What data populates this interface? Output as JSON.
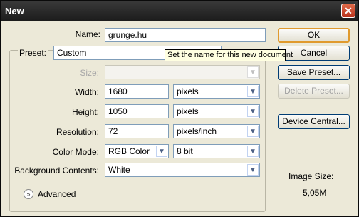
{
  "window": {
    "title": "New",
    "close_symbol": "✕"
  },
  "form": {
    "name_label": "Name:",
    "name_value": "grunge.hu",
    "preset_label": "Preset:",
    "preset_value": "Custom",
    "size_label": "Size:",
    "size_value": "",
    "width_label": "Width:",
    "width_value": "1680",
    "width_unit": "pixels",
    "height_label": "Height:",
    "height_value": "1050",
    "height_unit": "pixels",
    "resolution_label": "Resolution:",
    "resolution_value": "72",
    "resolution_unit": "pixels/inch",
    "color_mode_label": "Color Mode:",
    "color_mode_value": "RGB Color",
    "bit_depth_value": "8 bit",
    "background_label": "Background Contents:",
    "background_value": "White",
    "advanced_label": "Advanced"
  },
  "tooltip": "Set the name for this new document",
  "buttons": {
    "ok": "OK",
    "cancel": "Cancel",
    "save_preset": "Save Preset...",
    "delete_preset": "Delete Preset...",
    "device_central": "Device Central..."
  },
  "image_size": {
    "label": "Image Size:",
    "value": "5,05M"
  },
  "icons": {
    "dropdown": "chevron-down-icon",
    "advanced": "expand-icon"
  },
  "colors": {
    "dialog_bg": "#ece9d8",
    "titlebar": "#1c1c1c",
    "default_button_border": "#e09a2e",
    "tooltip_bg": "#ffffe1"
  }
}
